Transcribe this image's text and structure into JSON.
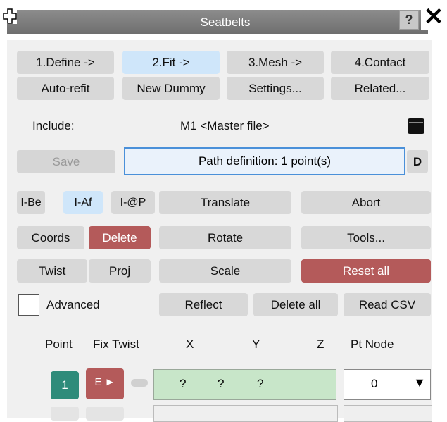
{
  "window": {
    "title": "Seatbelts",
    "help_label": "?",
    "close_label": "✕"
  },
  "workflow_tabs": [
    "1.Define ->",
    "2.Fit ->",
    "3.Mesh ->",
    "4.Contact"
  ],
  "top_buttons": [
    "Auto-refit",
    "New Dummy",
    "Settings...",
    "Related..."
  ],
  "include": {
    "label": "Include:",
    "value": "M1  <Master file>"
  },
  "save_label": "Save",
  "path_definition": "Path definition: 1 point(s)",
  "d_label": "D",
  "mode_buttons": [
    "I-Be",
    "I-Af",
    "I-@P"
  ],
  "edit_buttons": {
    "translate": "Translate",
    "abort": "Abort",
    "coords": "Coords",
    "delete": "Delete",
    "rotate": "Rotate",
    "tools": "Tools...",
    "twist": "Twist",
    "proj": "Proj",
    "scale": "Scale",
    "reset_all": "Reset all",
    "reflect": "Reflect",
    "delete_all": "Delete all",
    "read_csv": "Read CSV"
  },
  "advanced_label": "Advanced",
  "columns": [
    "Point",
    "Fix Twist",
    "X",
    "Y",
    "Z",
    "Pt Node"
  ],
  "row": {
    "point": "1",
    "e_label": "E ►",
    "x": "?",
    "y": "?",
    "z": "?",
    "node": "0",
    "node_arrow": "▼"
  },
  "colors": {
    "accent_teal": "#2e8b7a",
    "danger_red": "#b45a5a",
    "highlight_blue": "#cfe6fa",
    "coord_green": "#c8e6c9"
  }
}
